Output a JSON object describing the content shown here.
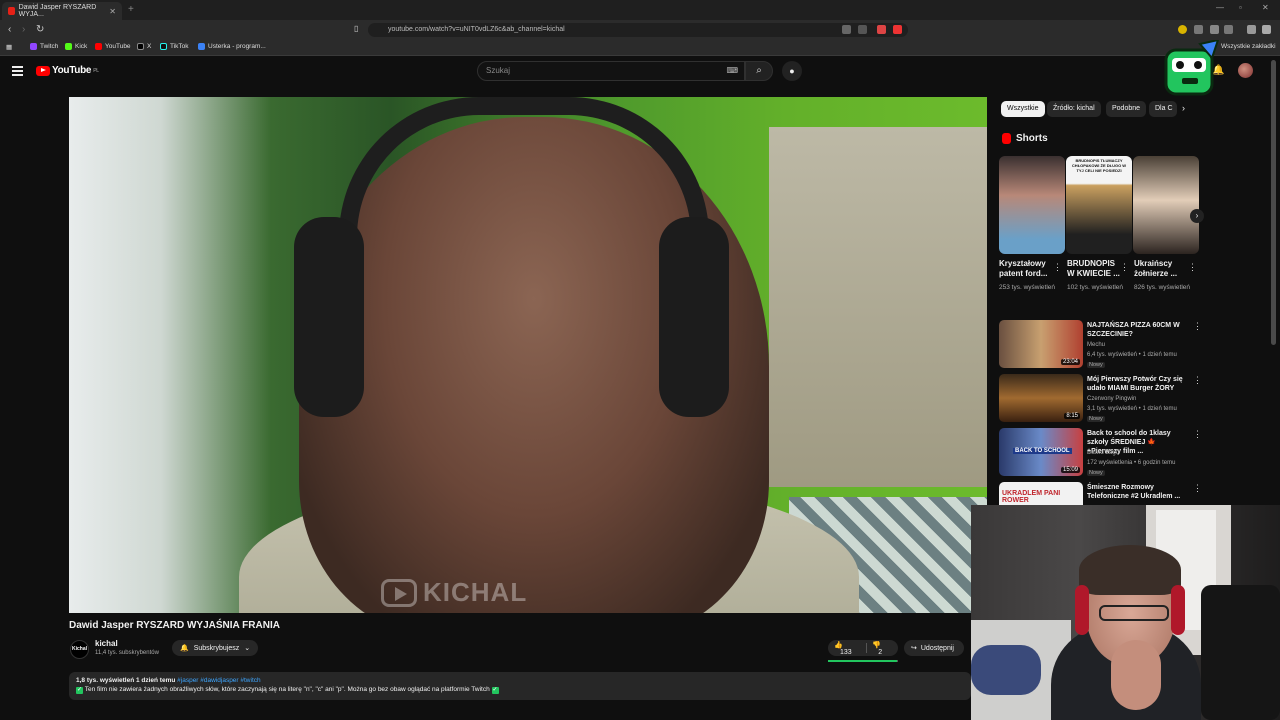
{
  "browser": {
    "tab_title": "Dawid Jasper RYSZARD WYJA...",
    "url": "youtube.com/watch?v=uNIT0vdLZ6c&ab_channel=kichal",
    "bookmarks": [
      "Twitch",
      "Kick",
      "YouTube",
      "X",
      "TikTok",
      "Usterka - program..."
    ],
    "all_bookmarks": "Wszystkie zakładki"
  },
  "youtube": {
    "logo_text": "YouTube",
    "logo_region": "PL",
    "search_placeholder": "Szukaj"
  },
  "video": {
    "title": "Dawid Jasper RYSZARD WYJAŚNIA FRANIA",
    "watermark": "KICHAL",
    "channel_name": "kichal",
    "channel_logo_text": "Kichal",
    "subscribers": "11,4 tys. subskrybentów",
    "subscribe_label": "Subskrybujesz",
    "likes": "133",
    "dislikes": "2",
    "share_label": "Udostępnij",
    "like_ratio": 0.985,
    "description_meta": "1,8 tys. wyświetleń  1 dzień temu",
    "description_tags": "#jasper #dawidjasper #twitch",
    "description_line": "Ten film nie zawiera żadnych obraźliwych słów, które zaczynają się na literę \"n\", \"c\" ani \"p\". Można go bez obaw oglądać na platformie Twitch"
  },
  "sidebar": {
    "chips": [
      "Wszystkie",
      "Źródło: kichal",
      "Podobne",
      "Dla C"
    ],
    "shorts_label": "Shorts",
    "shorts": [
      {
        "title": "Kryształowy patent ford...",
        "views": "253 tys. wyświetleń"
      },
      {
        "title": "BRUDNOPIS W KWIECIE ...",
        "views": "102 tys. wyświetleń",
        "thumb_text": "BRUDNOPIS TŁUMACZY CHŁOPAKOWI ŻE DŁUGO W TYJ CELI NIE POSIEDZI"
      },
      {
        "title": "Ukraińscy żołnierze ...",
        "views": "826 tys. wyświetleń"
      }
    ],
    "recommended": [
      {
        "title": "NAJTAŃSZA PIZZA 60CM W SZCZECINIE?",
        "channel": "Mechu",
        "meta": "6,4 tys. wyświetleń • 1 dzień temu",
        "badge": "Nowy",
        "duration": "23:04"
      },
      {
        "title": "Mój Pierwszy Potwór Czy się udało  MIAMI Burger ŻORY",
        "channel": "Czerwony Pingwin",
        "meta": "3,1 tys. wyświetleń • 1 dzień temu",
        "badge": "Nowy",
        "duration": "8:15"
      },
      {
        "title": "Back to school do 1klasy szkoły ŚREDNIEJ 🍁 +Pierwszy film ...",
        "channel": "Dawid Zago",
        "meta": "172 wyświetlenia • 6 godzin temu",
        "badge": "Nowy",
        "duration": "15:09",
        "thumb_text": "BACK TO SCHOOL"
      },
      {
        "title": "Śmieszne Rozmowy Telefoniczne #2  Ukradlem ...",
        "channel": "",
        "meta": "",
        "badge": "",
        "duration": "",
        "thumb_text": "UKRADLEM PANI ROWER"
      }
    ]
  },
  "colors": {
    "background": "#0f0f0f",
    "accent_red": "#ff0000",
    "chip_bg": "#272727",
    "like_green": "#22c55e"
  }
}
